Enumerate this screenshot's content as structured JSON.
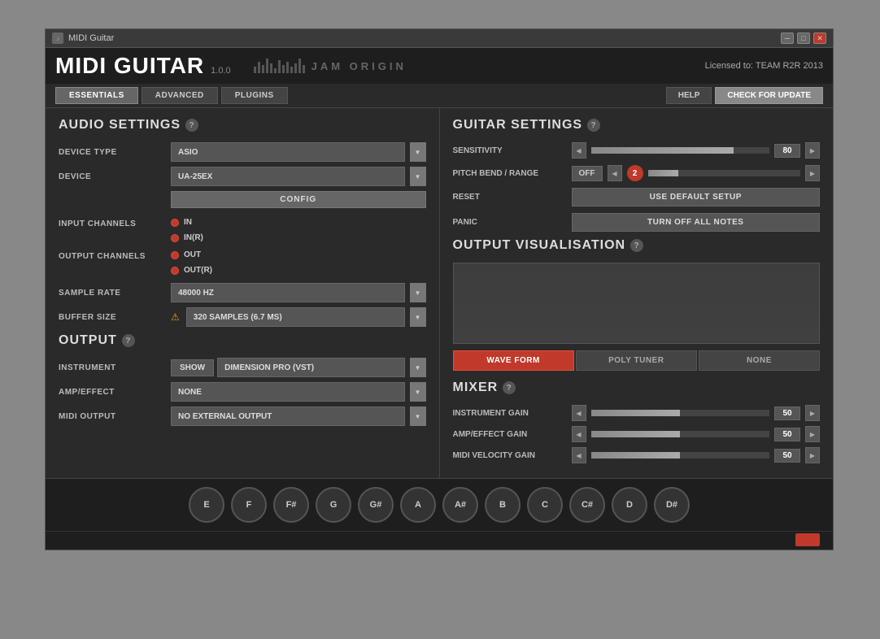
{
  "window": {
    "title": "MIDI Guitar",
    "icon": "♪"
  },
  "logo": {
    "text_midi": "MIDI",
    "text_guitar": "Guitar",
    "version": "1.0.0",
    "jam_origin": "JAM ORIGIN",
    "license": "Licensed to: TEAM R2R 2013"
  },
  "nav": {
    "tabs": [
      "ESSENTIALS",
      "ADVANCED",
      "PLUGINS"
    ],
    "active_tab": "ESSENTIALS",
    "help_label": "HELP",
    "update_label": "CHECK FOR UPDATE"
  },
  "audio_settings": {
    "title": "AUDIO SETTINGS",
    "device_type_label": "DEVICE TYPE",
    "device_type_value": "ASIO",
    "device_label": "DEVICE",
    "device_value": "UA-25EX",
    "config_label": "CONFIG",
    "input_channels_label": "INPUT CHANNELS",
    "input_channels": [
      "IN",
      "IN(R)"
    ],
    "output_channels_label": "OUTPUT CHANNELS",
    "output_channels": [
      "OUT",
      "OUT(R)"
    ],
    "sample_rate_label": "SAMPLE RATE",
    "sample_rate_value": "48000 HZ",
    "buffer_size_label": "BUFFER SIZE",
    "buffer_size_value": "320 SAMPLES (6.7 MS)",
    "buffer_warning": true
  },
  "output_section": {
    "title": "OUTPUT",
    "instrument_label": "INSTRUMENT",
    "show_label": "SHOW",
    "instrument_value": "DIMENSION PRO (VST)",
    "amp_effect_label": "AMP/EFFECT",
    "amp_effect_value": "NONE",
    "midi_output_label": "MIDI OUTPUT",
    "midi_output_value": "NO EXTERNAL OUTPUT"
  },
  "guitar_settings": {
    "title": "GUITAR SETTINGS",
    "sensitivity_label": "SENSITIVITY",
    "sensitivity_value": "80",
    "sensitivity_pct": 80,
    "pitch_bend_label": "PITCH BEND / RANGE",
    "pitch_bend_off": "OFF",
    "pitch_bend_value": "2",
    "reset_label": "RESET",
    "use_default_label": "USE DEFAULT SETUP",
    "panic_label": "PANIC",
    "turn_off_label": "TURN OFF ALL NOTES"
  },
  "output_visualisation": {
    "title": "OUTPUT VISUALISATION",
    "tabs": [
      "WAVE FORM",
      "POLY TUNER",
      "NONE"
    ],
    "active_tab": "WAVE FORM"
  },
  "mixer": {
    "title": "MIXER",
    "instrument_gain_label": "INSTRUMENT GAIN",
    "instrument_gain_value": "50",
    "instrument_gain_pct": 50,
    "amp_effect_gain_label": "AMP/EFFECT GAIN",
    "amp_effect_gain_value": "50",
    "amp_effect_gain_pct": 50,
    "midi_velocity_label": "MIDI VELOCITY GAIN",
    "midi_velocity_value": "50",
    "midi_velocity_pct": 50
  },
  "piano_keys": [
    "E",
    "F",
    "F#",
    "G",
    "G#",
    "A",
    "A#",
    "B",
    "C",
    "C#",
    "D",
    "D#"
  ]
}
